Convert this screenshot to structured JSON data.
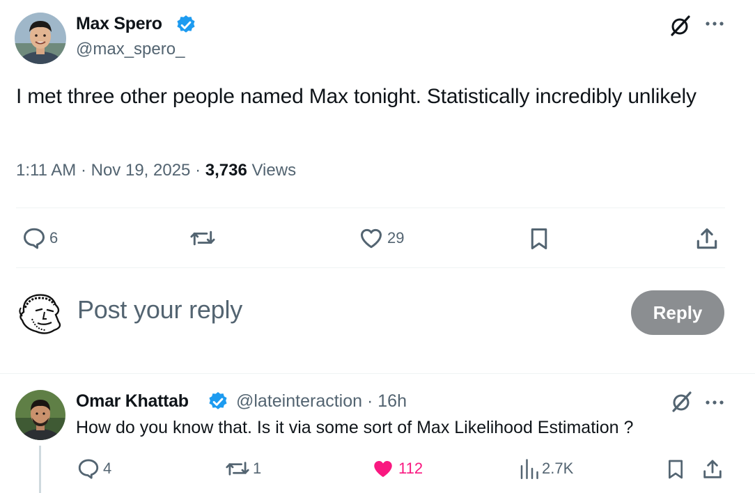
{
  "main_post": {
    "author_name": "Max Spero",
    "handle": "@max_spero_",
    "text": "I met three other people named Max tonight. Statistically incredibly unlikely",
    "time": "1:11 AM",
    "date": "Nov 19, 2025",
    "views_count": "3,736",
    "views_label": "Views",
    "replies": "6",
    "likes": "29"
  },
  "composer": {
    "placeholder": "Post your reply",
    "button_label": "Reply"
  },
  "reply_post": {
    "author_name": "Omar Khattab",
    "handle": "@lateinteraction",
    "age": "16h",
    "text": "How do you know that. Is it via some sort of Max Likelihood Estimation ?",
    "replies": "4",
    "reposts": "1",
    "likes": "112",
    "views": "2.7K"
  },
  "colors": {
    "verified_blue": "#1d9bf0",
    "like_pink": "#f91880",
    "secondary_text": "#536471",
    "disabled_button": "#8b8e91"
  },
  "icons": [
    "verified-badge-icon",
    "grok-icon",
    "more-icon",
    "reply-icon",
    "repost-icon",
    "like-icon",
    "bookmark-icon",
    "share-icon",
    "views-icon"
  ]
}
